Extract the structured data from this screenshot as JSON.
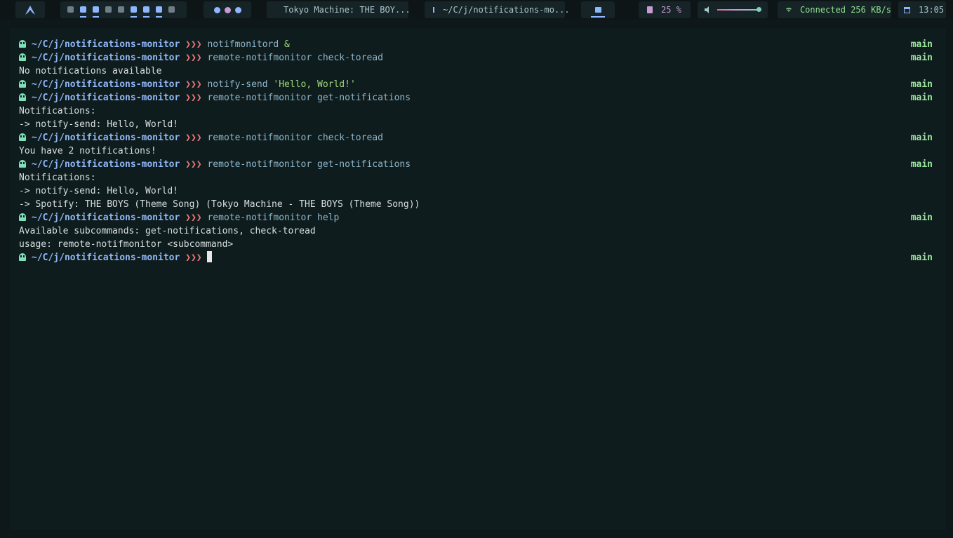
{
  "bar": {
    "arch_icon": "arch-logo-icon",
    "workspaces": [
      {
        "icon": "shield-icon",
        "color": "#6f7e86",
        "active": false
      },
      {
        "icon": "browser-icon",
        "color": "#8fb7ff",
        "active": true
      },
      {
        "icon": "terminal-icon",
        "color": "#8fb7ff",
        "active": true
      },
      {
        "icon": "code-icon",
        "color": "#6f7e86",
        "active": false
      },
      {
        "icon": "folder-icon",
        "color": "#6f7e86",
        "active": false
      },
      {
        "icon": "image-icon",
        "color": "#8fb7ff",
        "active": true
      },
      {
        "icon": "compass-icon",
        "color": "#8fb7ff",
        "active": true
      },
      {
        "icon": "chat-icon",
        "color": "#8fb7ff",
        "active": true
      },
      {
        "icon": "gear-icon",
        "color": "#6f7e86",
        "active": false
      }
    ],
    "media": [
      {
        "icon": "previous-icon",
        "color": "#8fb7ff"
      },
      {
        "icon": "pause-icon",
        "color": "#c89bd5"
      },
      {
        "icon": "next-icon",
        "color": "#8fb7ff"
      }
    ],
    "now_playing": "Tokyo Machine: THE BOY...",
    "window_title": "~/C/j/notifications-mo...",
    "cpu": "25 %",
    "volume_level": 1.0,
    "network": "Connected 256 KB/s",
    "clock": "13:05"
  },
  "terminal": {
    "prompt_path": "~/C/j/notifications-monitor",
    "prompt_arrows": "❯❯❯",
    "branch": "main",
    "lines": [
      {
        "type": "prompt",
        "cmd": "notifmonitord",
        "arg": "&",
        "arg_class": "str"
      },
      {
        "type": "prompt",
        "cmd": "remote-notifmonitor check-toread",
        "arg": "",
        "arg_class": "cmd"
      },
      {
        "type": "output",
        "text": "No notifications available"
      },
      {
        "type": "prompt",
        "cmd": "notify-send",
        "arg": "'Hello, World!'",
        "arg_class": "str"
      },
      {
        "type": "prompt",
        "cmd": "remote-notifmonitor get-notifications",
        "arg": "",
        "arg_class": "cmd"
      },
      {
        "type": "output",
        "text": "Notifications:"
      },
      {
        "type": "output",
        "text": "-> notify-send: Hello, World!"
      },
      {
        "type": "prompt",
        "cmd": "remote-notifmonitor check-toread",
        "arg": "",
        "arg_class": "cmd"
      },
      {
        "type": "output",
        "text": "You have 2 notifications!"
      },
      {
        "type": "prompt",
        "cmd": "remote-notifmonitor get-notifications",
        "arg": "",
        "arg_class": "cmd"
      },
      {
        "type": "output",
        "text": "Notifications:"
      },
      {
        "type": "output",
        "text": "-> notify-send: Hello, World!"
      },
      {
        "type": "output",
        "text": "-> Spotify: THE BOYS (Theme Song) (Tokyo Machine - THE BOYS (Theme Song))"
      },
      {
        "type": "prompt",
        "cmd": "remote-notifmonitor help",
        "arg": "",
        "arg_class": "cmd"
      },
      {
        "type": "output",
        "text": "Available subcommands: get-notifications, check-toread"
      },
      {
        "type": "output",
        "text": "usage: remote-notifmonitor <subcommand>"
      },
      {
        "type": "prompt",
        "cmd": "",
        "arg": "",
        "arg_class": "cmd",
        "cursor": true
      }
    ]
  }
}
